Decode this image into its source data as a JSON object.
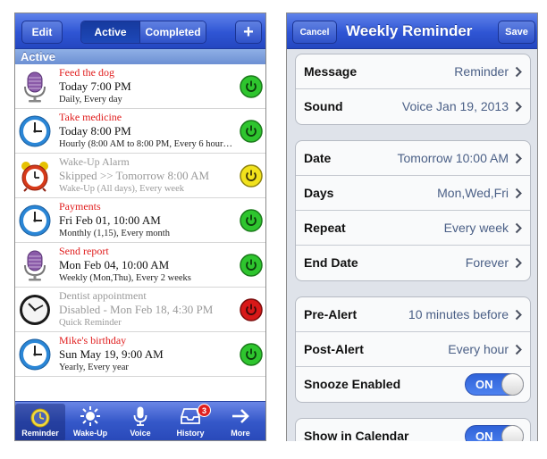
{
  "left": {
    "navbar": {
      "edit_label": "Edit",
      "segment_active": "Active",
      "segment_completed": "Completed",
      "add_label": "+"
    },
    "section_header": "Active",
    "reminders": [
      {
        "title": "Feed the dog",
        "time": "Today 7:00 PM",
        "detail": "Daily, Every day",
        "icon": "microphone-icon",
        "status": "active"
      },
      {
        "title": "Take medicine",
        "time": "Today 8:00 PM",
        "detail": "Hourly (8:00 AM to 8:00 PM, Every 6 hour…",
        "icon": "clock-icon",
        "status": "active"
      },
      {
        "title": "Wake-Up Alarm",
        "time": "Skipped >> Tomorrow 8:00 AM",
        "detail": "Wake-Up (All days), Every week",
        "icon": "alarm-clock-icon",
        "status": "skipped"
      },
      {
        "title": "Payments",
        "time": "Fri Feb 01, 10:00 AM",
        "detail": "Monthly (1,15), Every month",
        "icon": "clock-icon",
        "status": "active"
      },
      {
        "title": "Send report",
        "time": "Mon Feb 04, 10:00 AM",
        "detail": "Weekly (Mon,Thu), Every 2 weeks",
        "icon": "microphone-icon",
        "status": "active"
      },
      {
        "title": "Dentist appointment",
        "time": "Disabled - Mon Feb 18, 4:30 PM",
        "detail": "Quick Reminder",
        "icon": "wall-clock-icon",
        "status": "disabled"
      },
      {
        "title": "Mike's birthday",
        "time": "Sun May 19, 9:00 AM",
        "detail": "Yearly, Every year",
        "icon": "clock-icon",
        "status": "active"
      }
    ],
    "tabbar": {
      "tabs": [
        {
          "label": "Reminder",
          "icon": "clock-icon"
        },
        {
          "label": "Wake-Up",
          "icon": "sun-icon"
        },
        {
          "label": "Voice",
          "icon": "microphone-icon"
        },
        {
          "label": "History",
          "icon": "inbox-tray-icon"
        },
        {
          "label": "More",
          "icon": "arrow-right-icon"
        }
      ],
      "history_badge": "3"
    }
  },
  "right": {
    "navbar": {
      "cancel_label": "Cancel",
      "title": "Weekly Reminder",
      "save_label": "Save"
    },
    "groups": [
      [
        {
          "label": "Message",
          "value": "Reminder"
        },
        {
          "label": "Sound",
          "value": "Voice Jan 19, 2013"
        }
      ],
      [
        {
          "label": "Date",
          "value": "Tomorrow 10:00 AM"
        },
        {
          "label": "Days",
          "value": "Mon,Wed,Fri"
        },
        {
          "label": "Repeat",
          "value": "Every week"
        },
        {
          "label": "End Date",
          "value": "Forever"
        }
      ],
      [
        {
          "label": "Pre-Alert",
          "value": "10 minutes before"
        },
        {
          "label": "Post-Alert",
          "value": "Every hour"
        },
        {
          "label": "Snooze Enabled",
          "toggle": "ON"
        }
      ],
      [
        {
          "label": "Show in Calendar",
          "toggle": "ON"
        }
      ]
    ]
  },
  "colors": {
    "nav_blue": "#2f55d4",
    "reminder_title_red": "#e01d1d",
    "status_green": "#2ec52e",
    "status_yellow": "#f1e21c",
    "status_red": "#d81818",
    "detail_value_blue": "#4a5f86"
  }
}
